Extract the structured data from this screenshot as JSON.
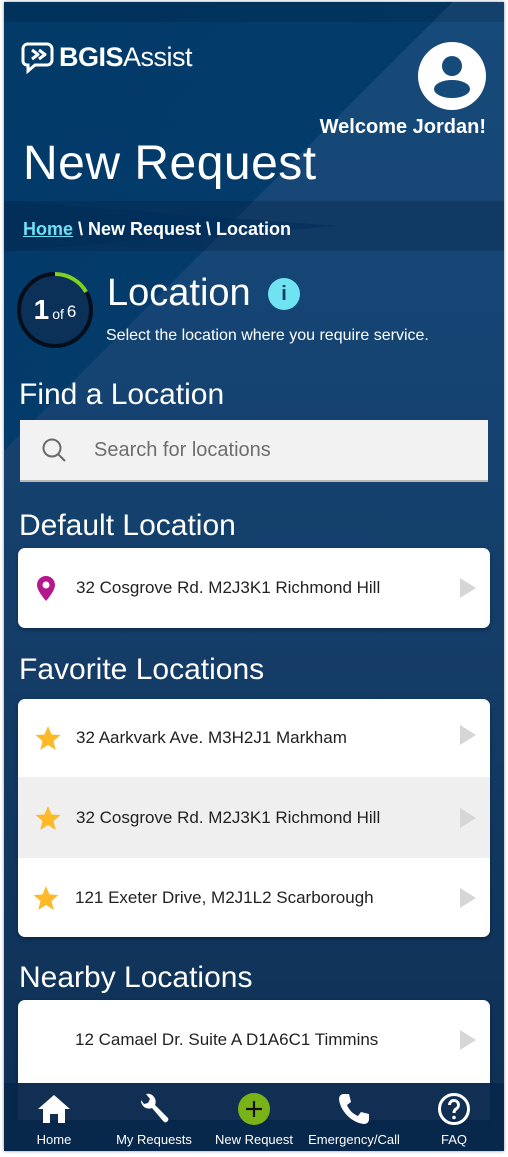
{
  "header": {
    "logo_bold": "BGIS",
    "logo_light": "Assist",
    "welcome": "Welcome Jordan!",
    "page_title": "New Request"
  },
  "breadcrumb": {
    "home": "Home",
    "rest": " \\ New Request \\ Location"
  },
  "step": {
    "current": "1",
    "of_label": "of",
    "total": "6",
    "progress_fraction": 0.1667,
    "title": "Location",
    "description": "Select the location where you require service.",
    "ring_color": "#7ed321"
  },
  "find": {
    "heading": "Find a Location",
    "search_placeholder": "Search for locations",
    "search_value": ""
  },
  "default_section": {
    "heading": "Default Location",
    "items": [
      {
        "icon": "map-pin-icon",
        "address": "32 Cosgrove Rd. M2J3K1 Richmond Hill"
      }
    ],
    "pin_color": "#b5178c"
  },
  "favorites_section": {
    "heading": "Favorite Locations",
    "star_color": "#fdb927",
    "items": [
      {
        "icon": "star-icon",
        "address": "32 Aarkvark Ave. M3H2J1 Markham"
      },
      {
        "icon": "star-icon",
        "address": "32 Cosgrove Rd. M2J3K1 Richmond Hill"
      },
      {
        "icon": "star-icon",
        "address": "121 Exeter Drive, M2J1L2 Scarborough"
      }
    ]
  },
  "nearby_section": {
    "heading": "Nearby Locations",
    "items": [
      {
        "address": "12 Camael Dr. Suite A D1A6C1 Timmins"
      }
    ]
  },
  "bottom_nav": {
    "items": [
      {
        "icon": "home-icon",
        "label": "Home"
      },
      {
        "icon": "wrench-icon",
        "label": "My Requests"
      },
      {
        "icon": "plus-circle-icon",
        "label": "New Request"
      },
      {
        "icon": "phone-icon",
        "label": "Emergency/Call"
      },
      {
        "icon": "help-circle-icon",
        "label": "FAQ"
      }
    ],
    "accent": "#7ab317"
  }
}
